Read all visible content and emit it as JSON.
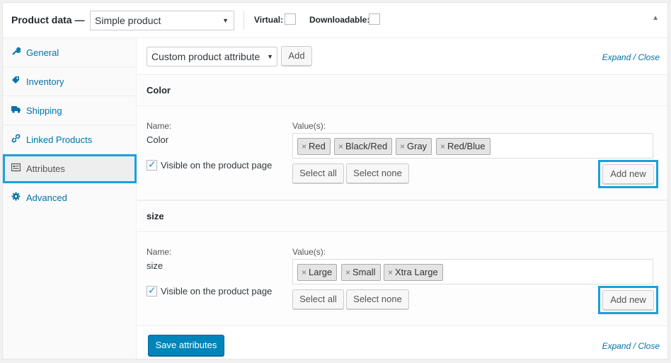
{
  "header": {
    "title": "Product data —",
    "product_type": "Simple product",
    "virtual_label": "Virtual:",
    "downloadable_label": "Downloadable:"
  },
  "sidebar": {
    "items": [
      {
        "label": "General",
        "icon": "wrench-icon"
      },
      {
        "label": "Inventory",
        "icon": "tag-icon"
      },
      {
        "label": "Shipping",
        "icon": "truck-icon"
      },
      {
        "label": "Linked Products",
        "icon": "link-icon"
      },
      {
        "label": "Attributes",
        "icon": "attributes-icon",
        "active": true
      },
      {
        "label": "Advanced",
        "icon": "gear-icon"
      }
    ]
  },
  "toolbar": {
    "attribute_select": "Custom product attribute",
    "add_label": "Add",
    "expand": "Expand",
    "sep": "/",
    "close": "Close"
  },
  "attributes": [
    {
      "title": "Color",
      "name_label": "Name:",
      "name_value": "Color",
      "values_label": "Value(s):",
      "values": [
        "Red",
        "Black/Red",
        "Gray",
        "Red/Blue"
      ],
      "visible_label": "Visible on the product page",
      "visible_checked": true,
      "select_all": "Select all",
      "select_none": "Select none",
      "add_new": "Add new"
    },
    {
      "title": "size",
      "name_label": "Name:",
      "name_value": "size",
      "values_label": "Value(s):",
      "values": [
        "Large",
        "Small",
        "Xtra Large"
      ],
      "visible_label": "Visible on the product page",
      "visible_checked": true,
      "select_all": "Select all",
      "select_none": "Select none",
      "add_new": "Add new"
    }
  ],
  "footer": {
    "save_label": "Save attributes",
    "expand": "Expand",
    "sep": "/",
    "close": "Close"
  },
  "colors": {
    "accent": "#0073aa",
    "primary": "#0085ba",
    "highlight": "#1aa0dc"
  }
}
